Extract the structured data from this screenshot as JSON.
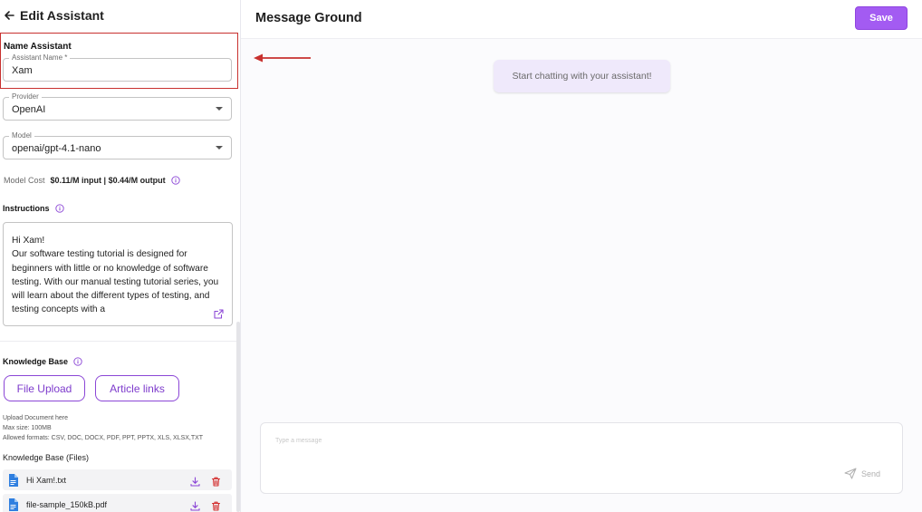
{
  "left_panel": {
    "title": "Edit Assistant",
    "name_section_label": "Name Assistant",
    "assistant_name": {
      "legend": "Assistant Name *",
      "value": "Xam"
    },
    "provider": {
      "legend": "Provider",
      "value": "OpenAI"
    },
    "model": {
      "legend": "Model",
      "value": "openai/gpt-4.1-nano"
    },
    "model_cost": {
      "label": "Model Cost",
      "value": "$0.11/M input | $0.44/M output"
    },
    "instructions": {
      "label": "Instructions",
      "text": "Hi Xam!\nOur software testing tutorial is designed for beginners with little or no knowledge of software testing. With our manual testing tutorial series, you will learn about the different types of testing, and testing concepts with a"
    },
    "knowledge_base": {
      "label": "Knowledge Base",
      "file_upload_button": "File Upload",
      "article_links_button": "Article links",
      "upload_hint": "Upload Document here",
      "max_size": "Max size: 100MB",
      "allowed_formats": "Allowed formats: CSV, DOC, DOCX, PDF, PPT, PPTX, XLS, XLSX,TXT",
      "files_label": "Knowledge Base (Files)",
      "files": [
        {
          "name": "Hi Xam!.txt"
        },
        {
          "name": "file-sample_150kB.pdf"
        }
      ]
    }
  },
  "right_panel": {
    "title": "Message Ground",
    "save_label": "Save",
    "empty_message": "Start chatting with your assistant!",
    "composer": {
      "placeholder": "Type a message",
      "send_label": "Send"
    }
  },
  "colors": {
    "accent": "#a35bf2",
    "accent_border": "#8b46d6",
    "highlight_box": "#c8312f",
    "delete_icon": "#d32f2f",
    "file_icon": "#2f7fe0"
  }
}
